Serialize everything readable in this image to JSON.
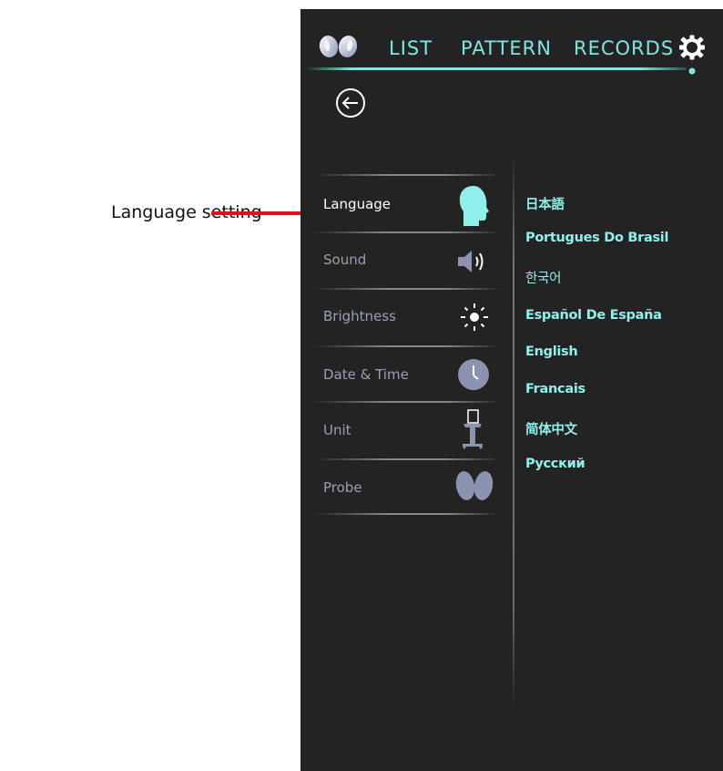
{
  "annotation": {
    "label": "Language setting",
    "line_color": "#e0101c"
  },
  "nav": {
    "items": [
      "LIST",
      "PATTERN",
      "RECORDS"
    ],
    "accent": "#7fe6e2"
  },
  "settings_menu": [
    {
      "label": "Language",
      "icon": "head-icon",
      "active": true
    },
    {
      "label": "Sound",
      "icon": "speaker-icon"
    },
    {
      "label": "Brightness",
      "icon": "sun-icon"
    },
    {
      "label": "Date & Time",
      "icon": "clock-icon"
    },
    {
      "label": "Unit",
      "icon": "device-unit-icon"
    },
    {
      "label": "Probe",
      "icon": "probes-icon"
    }
  ],
  "languages": [
    "日本語",
    "Portugues Do Brasil",
    "한국어",
    "Español De España",
    "English",
    "Francais",
    "简体中文",
    "Русский"
  ],
  "colors": {
    "background": "#232323",
    "label_inactive": "#9aa0b3",
    "icon_inactive": "#8c93b1",
    "icon_active": "#8ff0ec",
    "language_text": "#8ff0ec"
  }
}
